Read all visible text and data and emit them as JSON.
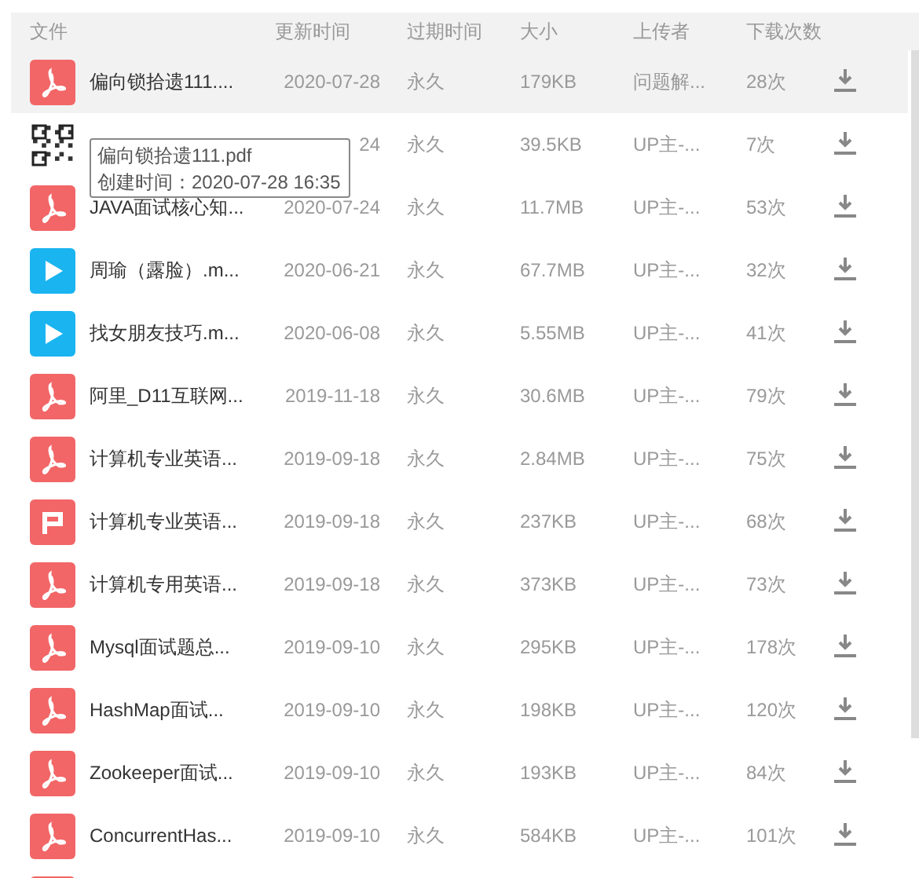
{
  "columns": [
    "文件",
    "更新时间",
    "过期时间",
    "大小",
    "上传者",
    "下载次数"
  ],
  "rows": [
    {
      "kind": "pdf",
      "selected": true,
      "name": "偏向锁拾遗111....",
      "date": "2020-07-28",
      "expire": "永久",
      "size": "179KB",
      "uploader": "问题解...",
      "count": "28次"
    },
    {
      "kind": "qr",
      "selected": false,
      "date": "24",
      "expire": "永久",
      "size": "39.5KB",
      "uploader": "UP主-...",
      "count": "7次"
    },
    {
      "kind": "pdf",
      "selected": false,
      "name": "JAVA面试核心知...",
      "date": "2020-07-24",
      "expire": "永久",
      "size": "11.7MB",
      "uploader": "UP主-...",
      "count": "53次"
    },
    {
      "kind": "video",
      "selected": false,
      "name": "周瑜（露脸）.m...",
      "date": "2020-06-21",
      "expire": "永久",
      "size": "67.7MB",
      "uploader": "UP主-...",
      "count": "32次"
    },
    {
      "kind": "video",
      "selected": false,
      "name": "找女朋友技巧.m...",
      "date": "2020-06-08",
      "expire": "永久",
      "size": "5.55MB",
      "uploader": "UP主-...",
      "count": "41次"
    },
    {
      "kind": "pdf",
      "selected": false,
      "name": "阿里_D11互联网...",
      "date": "2019-11-18",
      "expire": "永久",
      "size": "30.6MB",
      "uploader": "UP主-...",
      "count": "79次"
    },
    {
      "kind": "pdf",
      "selected": false,
      "name": "计算机专业英语...",
      "date": "2019-09-18",
      "expire": "永久",
      "size": "2.84MB",
      "uploader": "UP主-...",
      "count": "75次"
    },
    {
      "kind": "ppt",
      "selected": false,
      "name": "计算机专业英语...",
      "date": "2019-09-18",
      "expire": "永久",
      "size": "237KB",
      "uploader": "UP主-...",
      "count": "68次"
    },
    {
      "kind": "pdf",
      "selected": false,
      "name": "计算机专用英语...",
      "date": "2019-09-18",
      "expire": "永久",
      "size": "373KB",
      "uploader": "UP主-...",
      "count": "73次"
    },
    {
      "kind": "pdf",
      "selected": false,
      "name": "Mysql面试题总...",
      "date": "2019-09-10",
      "expire": "永久",
      "size": "295KB",
      "uploader": "UP主-...",
      "count": "178次"
    },
    {
      "kind": "pdf",
      "selected": false,
      "name": "HashMap面试...",
      "date": "2019-09-10",
      "expire": "永久",
      "size": "198KB",
      "uploader": "UP主-...",
      "count": "120次"
    },
    {
      "kind": "pdf",
      "selected": false,
      "name": "Zookeeper面试...",
      "date": "2019-09-10",
      "expire": "永久",
      "size": "193KB",
      "uploader": "UP主-...",
      "count": "84次"
    },
    {
      "kind": "pdf",
      "selected": false,
      "name": "ConcurrentHas...",
      "date": "2019-09-10",
      "expire": "永久",
      "size": "584KB",
      "uploader": "UP主-...",
      "count": "101次"
    },
    {
      "kind": "pdf",
      "selected": false
    }
  ],
  "tooltip": {
    "title": "偏向锁拾遗111.pdf",
    "created": "创建时间：2020-07-28 16:35"
  }
}
